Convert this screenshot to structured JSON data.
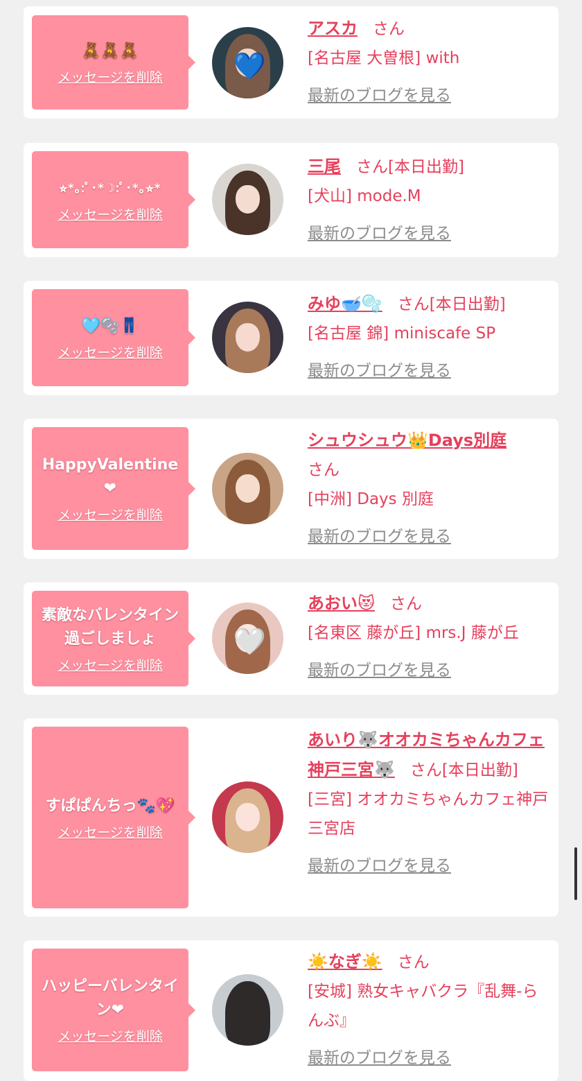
{
  "delete_label": "メッセージを削除",
  "blog_label": "最新のブログを見る",
  "san_label": "さん",
  "entries": [
    {
      "message": "🧸🧸🧸",
      "name": "アスカ",
      "status": "",
      "shop": "[名古屋 大曽根] with",
      "avatar_icon": "blue-heart-sticker-photo-icon"
    },
    {
      "message": "⭐︎*｡:ﾟ･*☽:ﾟ･*｡⭐︎*",
      "name": "三尾",
      "status": "[本日出勤]",
      "shop": "[犬山] mode.M",
      "avatar_icon": "profile-photo-icon"
    },
    {
      "message": "🩵🫧👖",
      "name": "みゆ🥣🫧",
      "status": "[本日出勤]",
      "shop": "[名古屋 錦] miniscafe SP",
      "avatar_icon": "profile-photo-icon"
    },
    {
      "message": "HappyValentine❤",
      "name": "シュウシュウ👑Days別庭",
      "status": "",
      "shop": "[中洲] Days 別庭",
      "avatar_icon": "profile-photo-icon"
    },
    {
      "message": "素敵なバレンタイン過ごしましょ",
      "name": "あおい😻",
      "status": "",
      "shop": "[名東区 藤が丘] mrs.J 藤が丘",
      "avatar_icon": "white-heart-sticker-photo-icon"
    },
    {
      "message": "すぱぱんちっ🐾💖",
      "name": "あいり🐺オオカミちゃんカフェ神戸三宮🐺",
      "status": "[本日出勤]",
      "shop": "[三宮] オオカミちゃんカフェ神戸三宮店",
      "avatar_icon": "profile-photo-icon"
    },
    {
      "message": "ハッピーバレンタイン❤",
      "name": "☀️なぎ☀️",
      "status": "",
      "shop": "[安城] 熟女キャバクラ『乱舞-らんぶ』",
      "avatar_icon": "profile-photo-icon"
    }
  ]
}
